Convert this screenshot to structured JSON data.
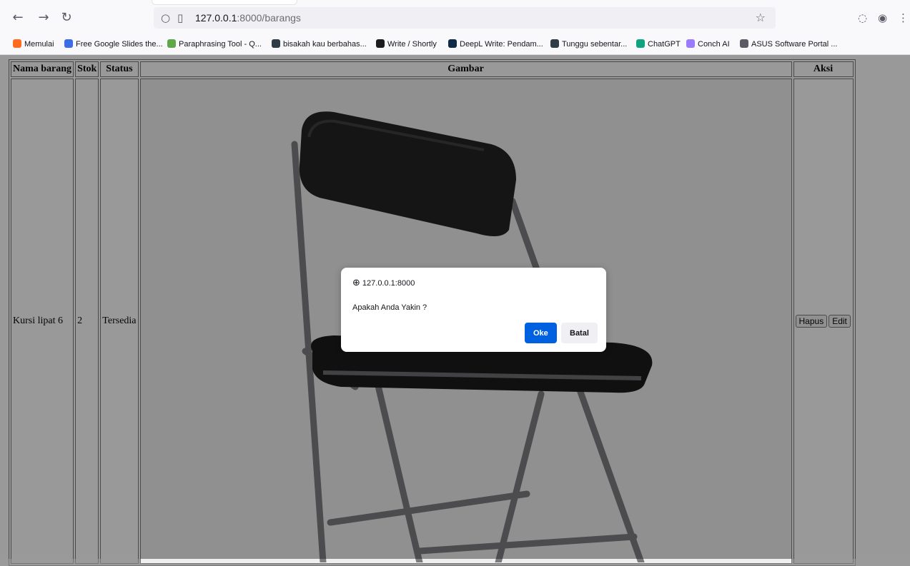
{
  "browser": {
    "url_host": "127.0.0.1",
    "url_path": ":8000/barangs",
    "bookmarks": [
      {
        "label": "Memulai",
        "color": "#ff6a1f"
      },
      {
        "label": "Free Google Slides the...",
        "color": "#3b6de6"
      },
      {
        "label": "Paraphrasing Tool - Q...",
        "color": "#5fa84a"
      },
      {
        "label": "bisakah kau berbahas...",
        "color": "#2f3c45"
      },
      {
        "label": "Write / Shortly",
        "color": "#1c1c1c"
      },
      {
        "label": "DeepL Write: Pendam...",
        "color": "#0f2b46"
      },
      {
        "label": "Tunggu sebentar...",
        "color": "#2f3c45"
      },
      {
        "label": "ChatGPT",
        "color": "#10a37f"
      },
      {
        "label": "Conch AI",
        "color": "#9a7bff"
      },
      {
        "label": "ASUS Software Portal ...",
        "color": "#5b5b66"
      }
    ]
  },
  "table": {
    "headers": [
      "Nama barang",
      "Stok",
      "Status",
      "Gambar",
      "Aksi"
    ],
    "row": {
      "nama": "Kursi lipat 6",
      "stok": "2",
      "status": "Tersedia"
    },
    "actions": {
      "delete_label": "Hapus",
      "edit_label": "Edit"
    }
  },
  "dialog": {
    "origin": "127.0.0.1:8000",
    "message": "Apakah Anda Yakin ?",
    "ok_label": "Oke",
    "cancel_label": "Batal"
  }
}
